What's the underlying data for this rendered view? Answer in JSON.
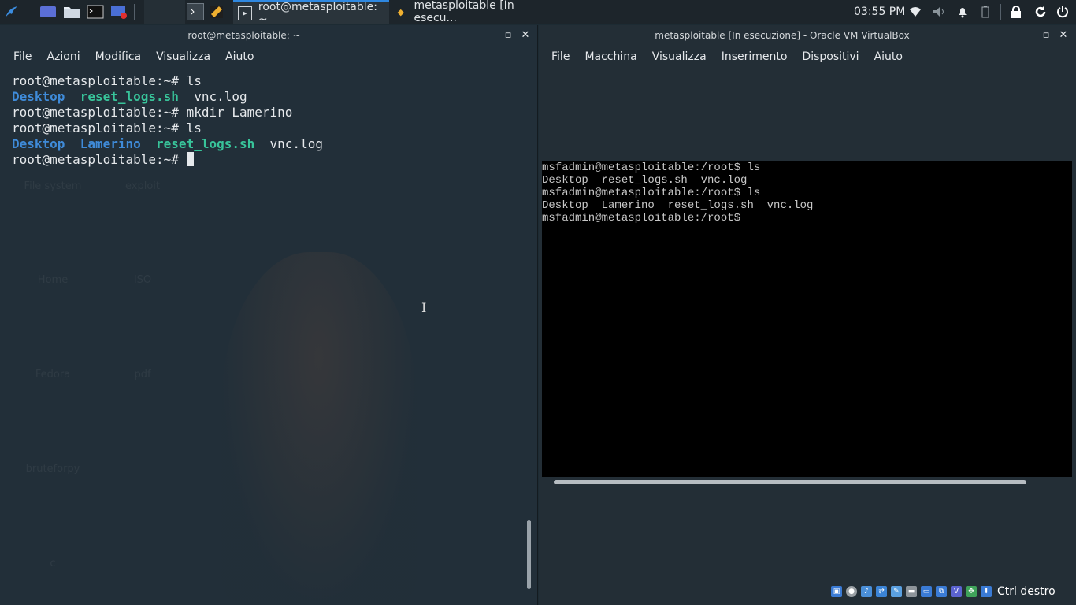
{
  "taskbar": {
    "launchers": [
      {
        "icon": "kali-dragon-icon"
      },
      {
        "icon": "show-desktop-icon"
      },
      {
        "icon": "file-manager-icon"
      },
      {
        "icon": "terminal-icon"
      },
      {
        "icon": "screen-recorder-icon"
      }
    ],
    "tasks": [
      {
        "label": "root@metasploitable: ~",
        "icon": "terminal-icon",
        "active": true
      },
      {
        "label": "metasploitable [In esecu...",
        "icon": "virtualbox-icon",
        "active": false
      }
    ],
    "clock": "03:55 PM",
    "tray_icons": [
      "wifi-icon",
      "volume-icon",
      "bell-icon",
      "battery-icon",
      "lock-icon",
      "refresh-icon",
      "power-icon"
    ]
  },
  "terminal": {
    "title": "root@metasploitable: ~",
    "menu": [
      "File",
      "Azioni",
      "Modifica",
      "Visualizza",
      "Aiuto"
    ],
    "lines": [
      {
        "prompt": "root@metasploitable:~# ",
        "cmd": "ls"
      },
      {
        "listing": [
          {
            "text": "Desktop",
            "kind": "dir"
          },
          {
            "text": "reset_logs.sh",
            "kind": "exe"
          },
          {
            "text": "vnc.log",
            "kind": "file"
          }
        ]
      },
      {
        "prompt": "root@metasploitable:~# ",
        "cmd": "mkdir Lamerino"
      },
      {
        "prompt": "root@metasploitable:~# ",
        "cmd": "ls"
      },
      {
        "listing": [
          {
            "text": "Desktop",
            "kind": "dir"
          },
          {
            "text": "Lamerino",
            "kind": "dir"
          },
          {
            "text": "reset_logs.sh",
            "kind": "exe"
          },
          {
            "text": "vnc.log",
            "kind": "file"
          }
        ]
      },
      {
        "prompt": "root@metasploitable:~# ",
        "cmd": ""
      }
    ]
  },
  "desktop_icons": [
    "File system",
    "exploit",
    "Home",
    "ISO",
    "Fedora",
    "pdf",
    "bruteforpy",
    "c"
  ],
  "vbox": {
    "title": "metasploitable [In esecuzione] - Oracle VM VirtualBox",
    "menu": [
      "File",
      "Macchina",
      "Visualizza",
      "Inserimento",
      "Dispositivi",
      "Aiuto"
    ],
    "console_lines": [
      "msfadmin@metasploitable:/root$ ls",
      "Desktop  reset_logs.sh  vnc.log",
      "msfadmin@metasploitable:/root$ ls",
      "Desktop  Lamerino  reset_logs.sh  vnc.log",
      "msfadmin@metasploitable:/root$"
    ],
    "host_key": "Ctrl destro",
    "status_icons": [
      "hard-disk-icon",
      "optical-drive-icon",
      "audio-icon",
      "network-icon",
      "usb-icon",
      "shared-folder-icon",
      "display-icon",
      "recording-icon",
      "virtualization-icon",
      "mouse-integration-icon",
      "keyboard-icon"
    ]
  }
}
